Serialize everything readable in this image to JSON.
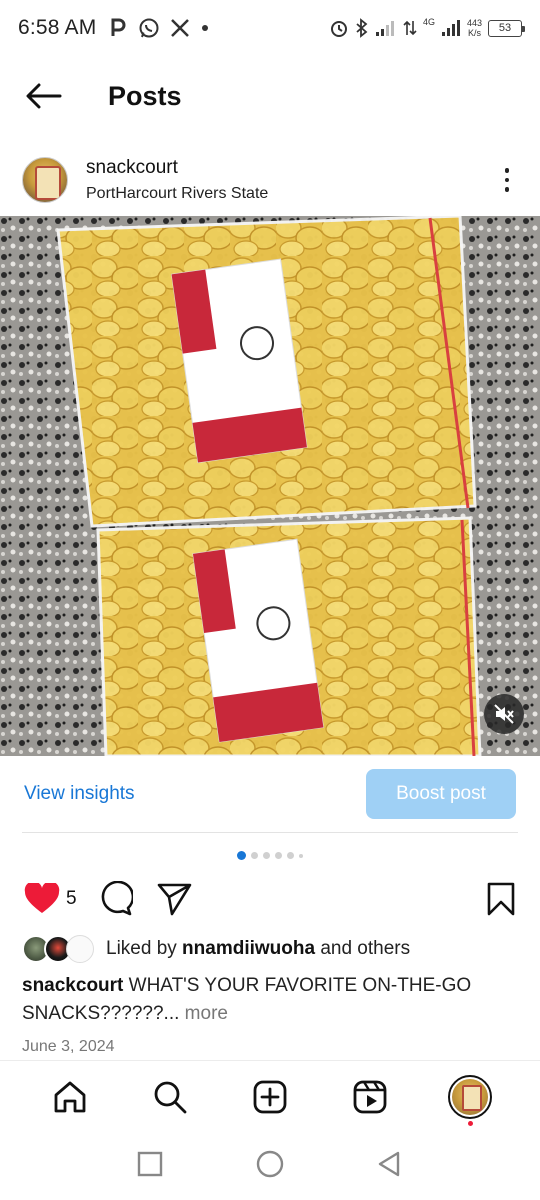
{
  "status_bar": {
    "time": "6:58 AM",
    "left_icons": [
      "parking-icon",
      "whatsapp-icon",
      "x-icon",
      "dot-icon"
    ],
    "net_speed_value": "443",
    "net_speed_unit": "K/s",
    "network_label": "4G",
    "battery": "53"
  },
  "header": {
    "title": "Posts",
    "back_icon": "arrow-left-icon"
  },
  "post": {
    "username": "snackcourt",
    "location": "PortHarcourt Rivers State",
    "menu_icon": "more-vertical-icon",
    "image_icon": "video-muted-icon",
    "view_insights": "View insights",
    "boost_post": "Boost post",
    "carousel_count": 6,
    "carousel_active": 0,
    "like_count": "5",
    "liked_by_prefix": "Liked by ",
    "liked_by_user": "nnamdiiwuoha",
    "liked_by_suffix": " and others",
    "caption_user": "snackcourt",
    "caption_text": " WHAT'S YOUR FAVORITE ON-THE-GO SNACKS??????",
    "caption_ellipsis": "...",
    "caption_more": " more",
    "date": "June 3, 2024"
  },
  "bottom_nav": {
    "items": [
      "home-icon",
      "search-icon",
      "create-icon",
      "reels-icon",
      "profile-avatar"
    ]
  },
  "system_nav": {
    "items": [
      "recents-square-icon",
      "home-circle-icon",
      "back-triangle-icon"
    ]
  },
  "colors": {
    "accent": "#1877d6",
    "boost_bg": "#9fd0f5",
    "like_red": "#ed1b38"
  }
}
